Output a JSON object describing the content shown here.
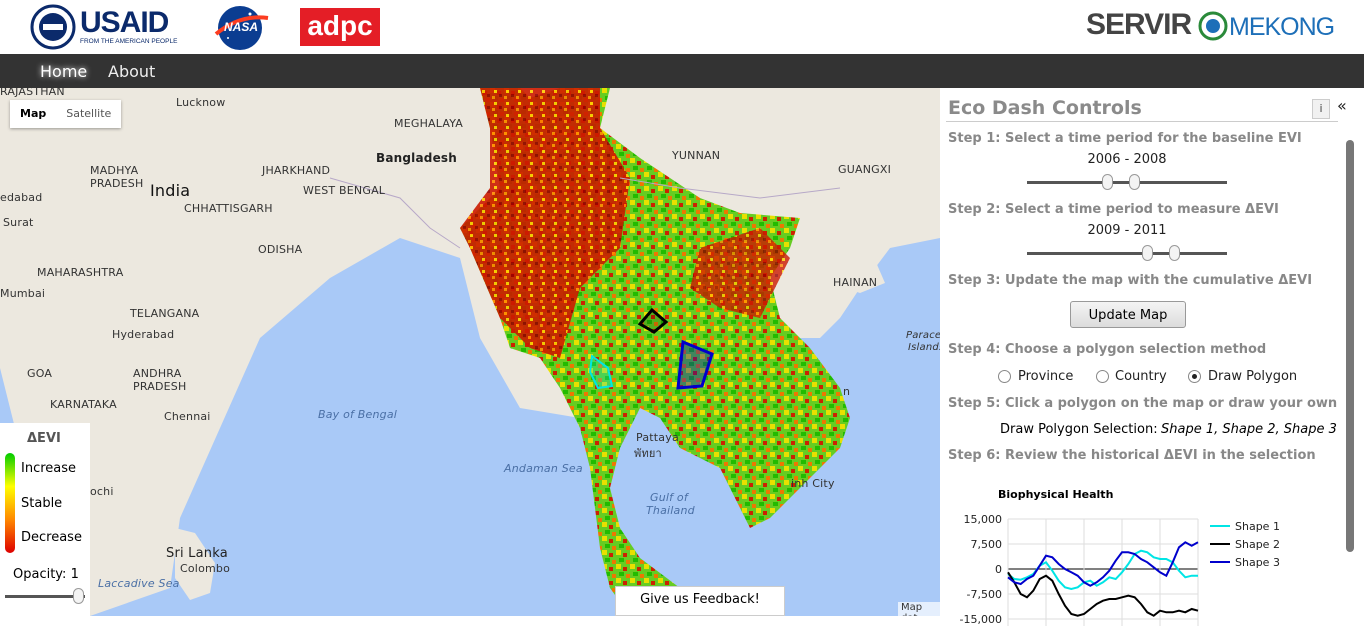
{
  "header": {
    "usaid_logo": "USAID",
    "usaid_tagline": "FROM THE AMERICAN PEOPLE",
    "nasa_logo": "NASA",
    "adpc_logo": "adpc",
    "servir_logo_left": "SERVIR",
    "servir_logo_right": "MEKONG"
  },
  "nav": {
    "home": "Home",
    "about": "About"
  },
  "map": {
    "map_type_map": "Map",
    "map_type_satellite": "Satellite",
    "labels": {
      "rajasthan": "RAJASTHAN",
      "lucknow": "Lucknow",
      "bangladesh": "Bangladesh",
      "meghalaya": "MEGHALAYA",
      "madhya_pradesh": "MADHYA PRADESH",
      "india": "India",
      "jharkhand": "JHARKHAND",
      "west_bengal": "WEST BENGAL",
      "edabad": "edabad",
      "chhattisgarh": "CHHATTISGARH",
      "surat": "Surat",
      "odisha": "ODISHA",
      "maharashtra": "MAHARASHTRA",
      "mumbai": "Mumbai",
      "telangana": "TELANGANA",
      "hyderabad": "Hyderabad",
      "goa": "GOA",
      "andhra_pradesh": "ANDHRA PRADESH",
      "karnataka": "KARNATAKA",
      "chennai": "Chennai",
      "bay_of_bengal": "Bay of Bengal",
      "andaman_sea": "Andaman Sea",
      "gulf_of_thailand_1": "Gulf of",
      "gulf_of_thailand_2": "Thailand",
      "sri_lanka": "Sri Lanka",
      "colombo": "Colombo",
      "laccadive_sea": "Laccadive Sea",
      "ochi": "ochi",
      "yunnan": "YUNNAN",
      "guangxi": "GUANGXI",
      "hainan": "HAINAN",
      "pattaya": "Pattaya",
      "pattaya_thai": "พัทยา",
      "paracel_1": "Paracel",
      "paracel_2": "Islands",
      "inh_city": "inh City",
      "n_edge": "n"
    },
    "feedback_label": "Give us Feedback!",
    "map_data_label": "Map dat"
  },
  "legend": {
    "title": "ΔEVI",
    "increase": "Increase",
    "stable": "Stable",
    "decrease": "Decrease",
    "opacity_label": "Opacity: 1",
    "opacity_value": 1.0
  },
  "panel": {
    "title": "Eco Dash Controls",
    "info_button": "i",
    "collapse_button": "«",
    "step1": "Step 1: Select a time period for the baseline EVI",
    "step1_range": "2006 - 2008",
    "step1_start": 2006,
    "step1_end": 2008,
    "step2": "Step 2: Select a time period to measure ΔEVI",
    "step2_range": "2009 - 2011",
    "step2_start": 2009,
    "step2_end": 2011,
    "step3": "Step 3: Update the map with the cumulative ΔEVI",
    "update_button": "Update Map",
    "step4": "Step 4: Choose a polygon selection method",
    "options": [
      "Province",
      "Country",
      "Draw Polygon"
    ],
    "selected_option": "Draw Polygon",
    "step5": "Step 5: Click a polygon on the map or draw your own",
    "selection_label": "Draw Polygon Selection:",
    "selection_value": "Shape 1, Shape 2, Shape 3",
    "step6": "Step 6: Review the historical ΔEVI in the selection"
  },
  "chart_data": {
    "type": "line",
    "title": "Biophysical Health",
    "y_ticks": [
      "15,000",
      "7,500",
      "0",
      "-7,500",
      "-15,000"
    ],
    "ylim": [
      -15000,
      15000
    ],
    "series": [
      {
        "name": "Shape 1",
        "color": "#00e5e5",
        "values": [
          -1500,
          -3000,
          -3200,
          -2500,
          -1500,
          1000,
          2000,
          -500,
          -3500,
          -5500,
          -6000,
          -5500,
          -4000,
          -3500,
          -5000,
          -4000,
          -2500,
          -3000,
          -1000,
          1500,
          4500,
          5500,
          5000,
          3500,
          3000,
          3000,
          2000,
          -500,
          -2500,
          -2000,
          -2000
        ]
      },
      {
        "name": "Shape 2",
        "color": "#000000",
        "values": [
          -1000,
          -4000,
          -7500,
          -8500,
          -6500,
          -3000,
          -2000,
          -3500,
          -7500,
          -11000,
          -13500,
          -14000,
          -13500,
          -12000,
          -10500,
          -9500,
          -9000,
          -9000,
          -8500,
          -8000,
          -8500,
          -10500,
          -13000,
          -14000,
          -12500,
          -13000,
          -13000,
          -12500,
          -13000,
          -12000,
          -12500
        ]
      },
      {
        "name": "Shape 3",
        "color": "#0000cc",
        "values": [
          -2500,
          -4000,
          -4500,
          -3000,
          -2000,
          1000,
          4000,
          3500,
          1500,
          0,
          -1000,
          -2000,
          -4000,
          -5000,
          -4000,
          -2500,
          -500,
          2500,
          5000,
          5000,
          4500,
          3000,
          2000,
          500,
          -1000,
          -2000,
          2000,
          6500,
          8000,
          7000,
          8000
        ]
      }
    ]
  }
}
